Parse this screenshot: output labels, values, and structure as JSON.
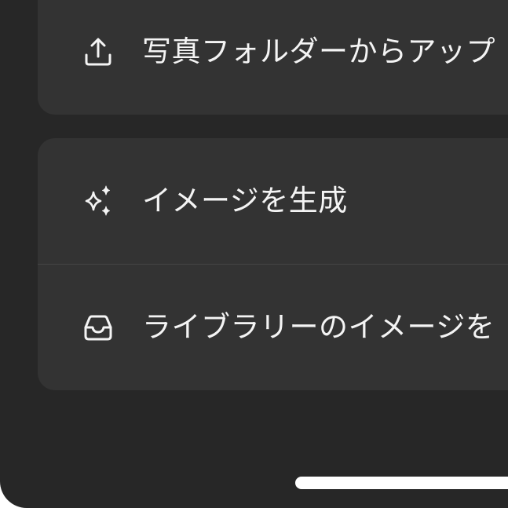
{
  "menu": {
    "items": [
      {
        "label": "写真フォルダーからアップ",
        "icon": "upload-icon"
      },
      {
        "label": "イメージを生成",
        "icon": "sparkles-icon"
      },
      {
        "label": "ライブラリーのイメージを",
        "icon": "inbox-tray-icon"
      }
    ]
  },
  "colors": {
    "background": "#272727",
    "card": "#333333",
    "divider": "#454545",
    "text": "#f4f4f4",
    "home_indicator": "#ffffff"
  }
}
